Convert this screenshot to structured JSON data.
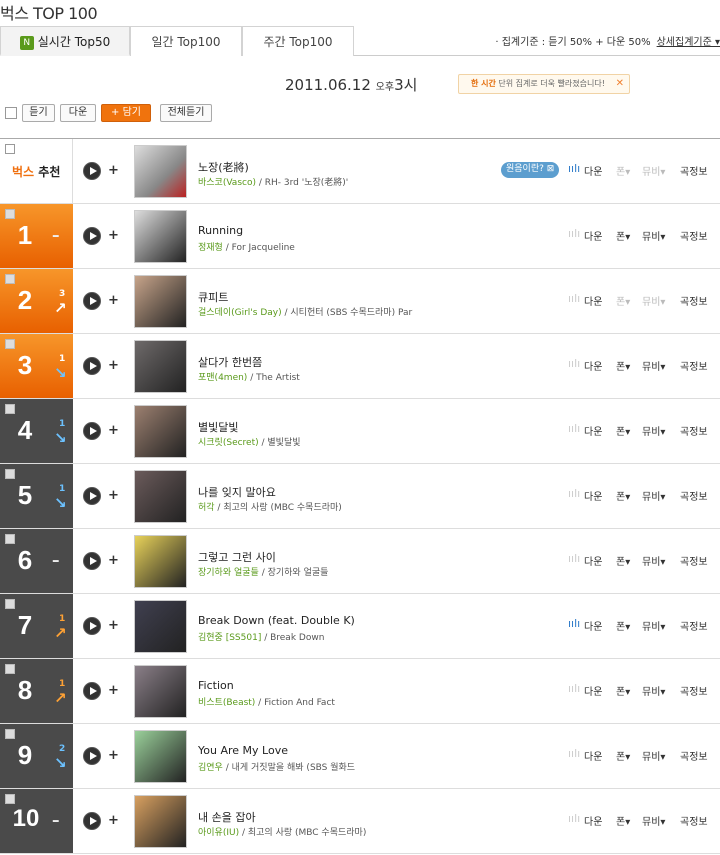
{
  "header": {
    "title": "벅스 TOP 100"
  },
  "tabs": [
    {
      "label": "실시간 Top50",
      "badge": "N"
    },
    {
      "label": "일간 Top100"
    },
    {
      "label": "주간 Top100"
    }
  ],
  "criteria": {
    "text": "· 집계기준 : 듣기 50% + 다운 50%",
    "link": "상세집계기준 ▾"
  },
  "date": {
    "date": "2011.06.12",
    "ampm": "오후",
    "hour": "3시"
  },
  "notice": {
    "strong": "한 시간",
    "text": "단위 집계로 더욱 빨라졌습니다!",
    "close": "✕"
  },
  "toolbar": {
    "listen": "듣기",
    "download": "다운",
    "add": "+ 담기",
    "listen_all": "전체듣기"
  },
  "recommend": {
    "prefix": "벅스",
    "label": "추천",
    "tooltip": "원음이란? ⊠",
    "song": "노장(老將)",
    "artist": "바스코(Vasco)",
    "album": "RH- 3rd '노장(老將)'"
  },
  "actions": {
    "eq": "ıılı",
    "download": "다운",
    "phone": "폰▾",
    "mv": "뮤비▾",
    "info": "곡정보",
    "sep": "|"
  },
  "chart_rows": [
    {
      "rank": "1",
      "change": "–",
      "dir": "same",
      "song": "Running",
      "artist": "정재형",
      "album": "For Jacqueline",
      "mv": true,
      "phone": true,
      "eq_on": false
    },
    {
      "rank": "2",
      "change": "3",
      "dir": "up",
      "song": "큐피트",
      "artist": "걸스데이(Girl's Day)",
      "album": "시티헌터 (SBS 수목드라마) Par",
      "mv": false,
      "phone": false,
      "eq_on": false
    },
    {
      "rank": "3",
      "change": "1",
      "dir": "down",
      "song": "살다가 한번쯤",
      "artist": "포맨(4men)",
      "album": "The Artist",
      "mv": true,
      "phone": true,
      "eq_on": false
    },
    {
      "rank": "4",
      "change": "1",
      "dir": "down",
      "song": "별빛달빛",
      "artist": "시크릿(Secret)",
      "album": "별빛달빛",
      "mv": true,
      "phone": true,
      "eq_on": false
    },
    {
      "rank": "5",
      "change": "1",
      "dir": "down",
      "song": "나를 잊지 말아요",
      "artist": "허각",
      "album": "최고의 사랑 (MBC 수목드라마)",
      "mv": true,
      "phone": true,
      "eq_on": false
    },
    {
      "rank": "6",
      "change": "–",
      "dir": "same",
      "song": "그렇고 그런 사이",
      "artist": "장기하와 얼굴들",
      "album": "장기하와 얼굴들",
      "mv": true,
      "phone": true,
      "eq_on": false
    },
    {
      "rank": "7",
      "change": "1",
      "dir": "up",
      "song": "Break Down (feat. Double K)",
      "artist": "김현중 [SS501]",
      "album": "Break Down",
      "mv": true,
      "phone": true,
      "eq_on": true
    },
    {
      "rank": "8",
      "change": "1",
      "dir": "up",
      "song": "Fiction",
      "artist": "비스트(Beast)",
      "album": "Fiction And Fact",
      "mv": true,
      "phone": true,
      "eq_on": false
    },
    {
      "rank": "9",
      "change": "2",
      "dir": "down",
      "song": "You Are My Love",
      "artist": "김연우",
      "album": "내게 거짓말을 해봐 (SBS 월화드",
      "mv": true,
      "phone": true,
      "eq_on": false
    },
    {
      "rank": "10",
      "change": "–",
      "dir": "same",
      "song": "내 손을 잡아",
      "artist": "아이유(IU)",
      "album": "최고의 사랑 (MBC 수목드라마)",
      "mv": true,
      "phone": true,
      "eq_on": false
    }
  ],
  "thumb_colors": [
    "#bbb",
    "#ddd",
    "#c7a48a",
    "#6e6a6a",
    "#9c8070",
    "#6b5b5b",
    "#e8d25a",
    "#404050",
    "#8a7f88",
    "#9ad09a",
    "#d8a060"
  ]
}
